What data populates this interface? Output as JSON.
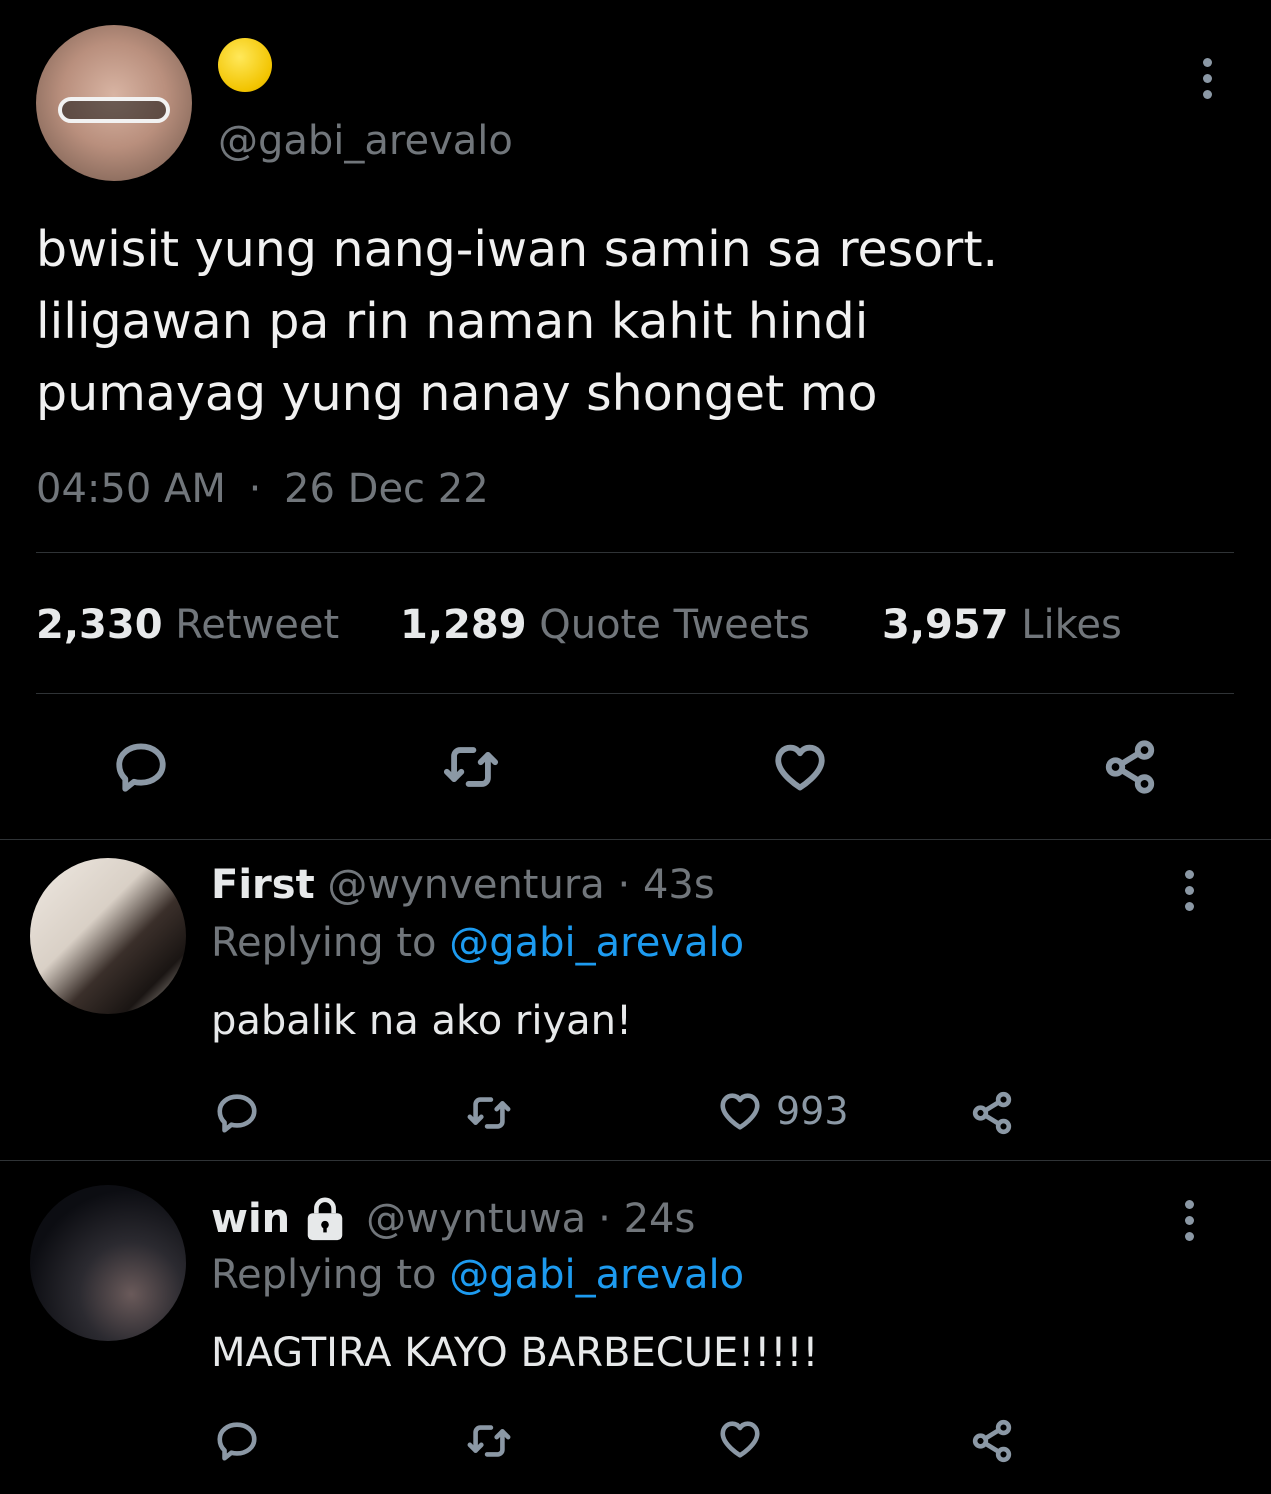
{
  "tweet": {
    "display_name": "🌕",
    "handle": "@gabi_arevalo",
    "text_lines": [
      "bwisit yung nang-iwan samin sa resort.",
      "liligawan pa rin naman kahit hindi",
      "pumayag yung nanay shonget mo"
    ],
    "time": "04:50 AM",
    "separator": "·",
    "date": "26 Dec 22",
    "stats": {
      "retweets_count": "2,330",
      "retweets_label": "Retweet",
      "quotes_count": "1,289",
      "quotes_label": "Quote Tweets",
      "likes_count": "3,957",
      "likes_label": "Likes"
    }
  },
  "replies": [
    {
      "name": "First",
      "handle": "@wynventura",
      "time": "· 43s",
      "replying_prefix": "Replying to",
      "replying_to": "@gabi_arevalo",
      "text": "pabalik na ako riyan!",
      "likes": "993"
    },
    {
      "name": "win",
      "handle": "@wyntuwa",
      "time": "· 24s",
      "replying_prefix": "Replying to",
      "replying_to": "@gabi_arevalo",
      "text": "MAGTIRA KAYO BARBECUE!!!!!",
      "likes": ""
    }
  ],
  "colors": {
    "background": "#000000",
    "text": "#e7e9ea",
    "muted": "#71767b",
    "link": "#1d9bf0",
    "divider": "#2f3336"
  }
}
